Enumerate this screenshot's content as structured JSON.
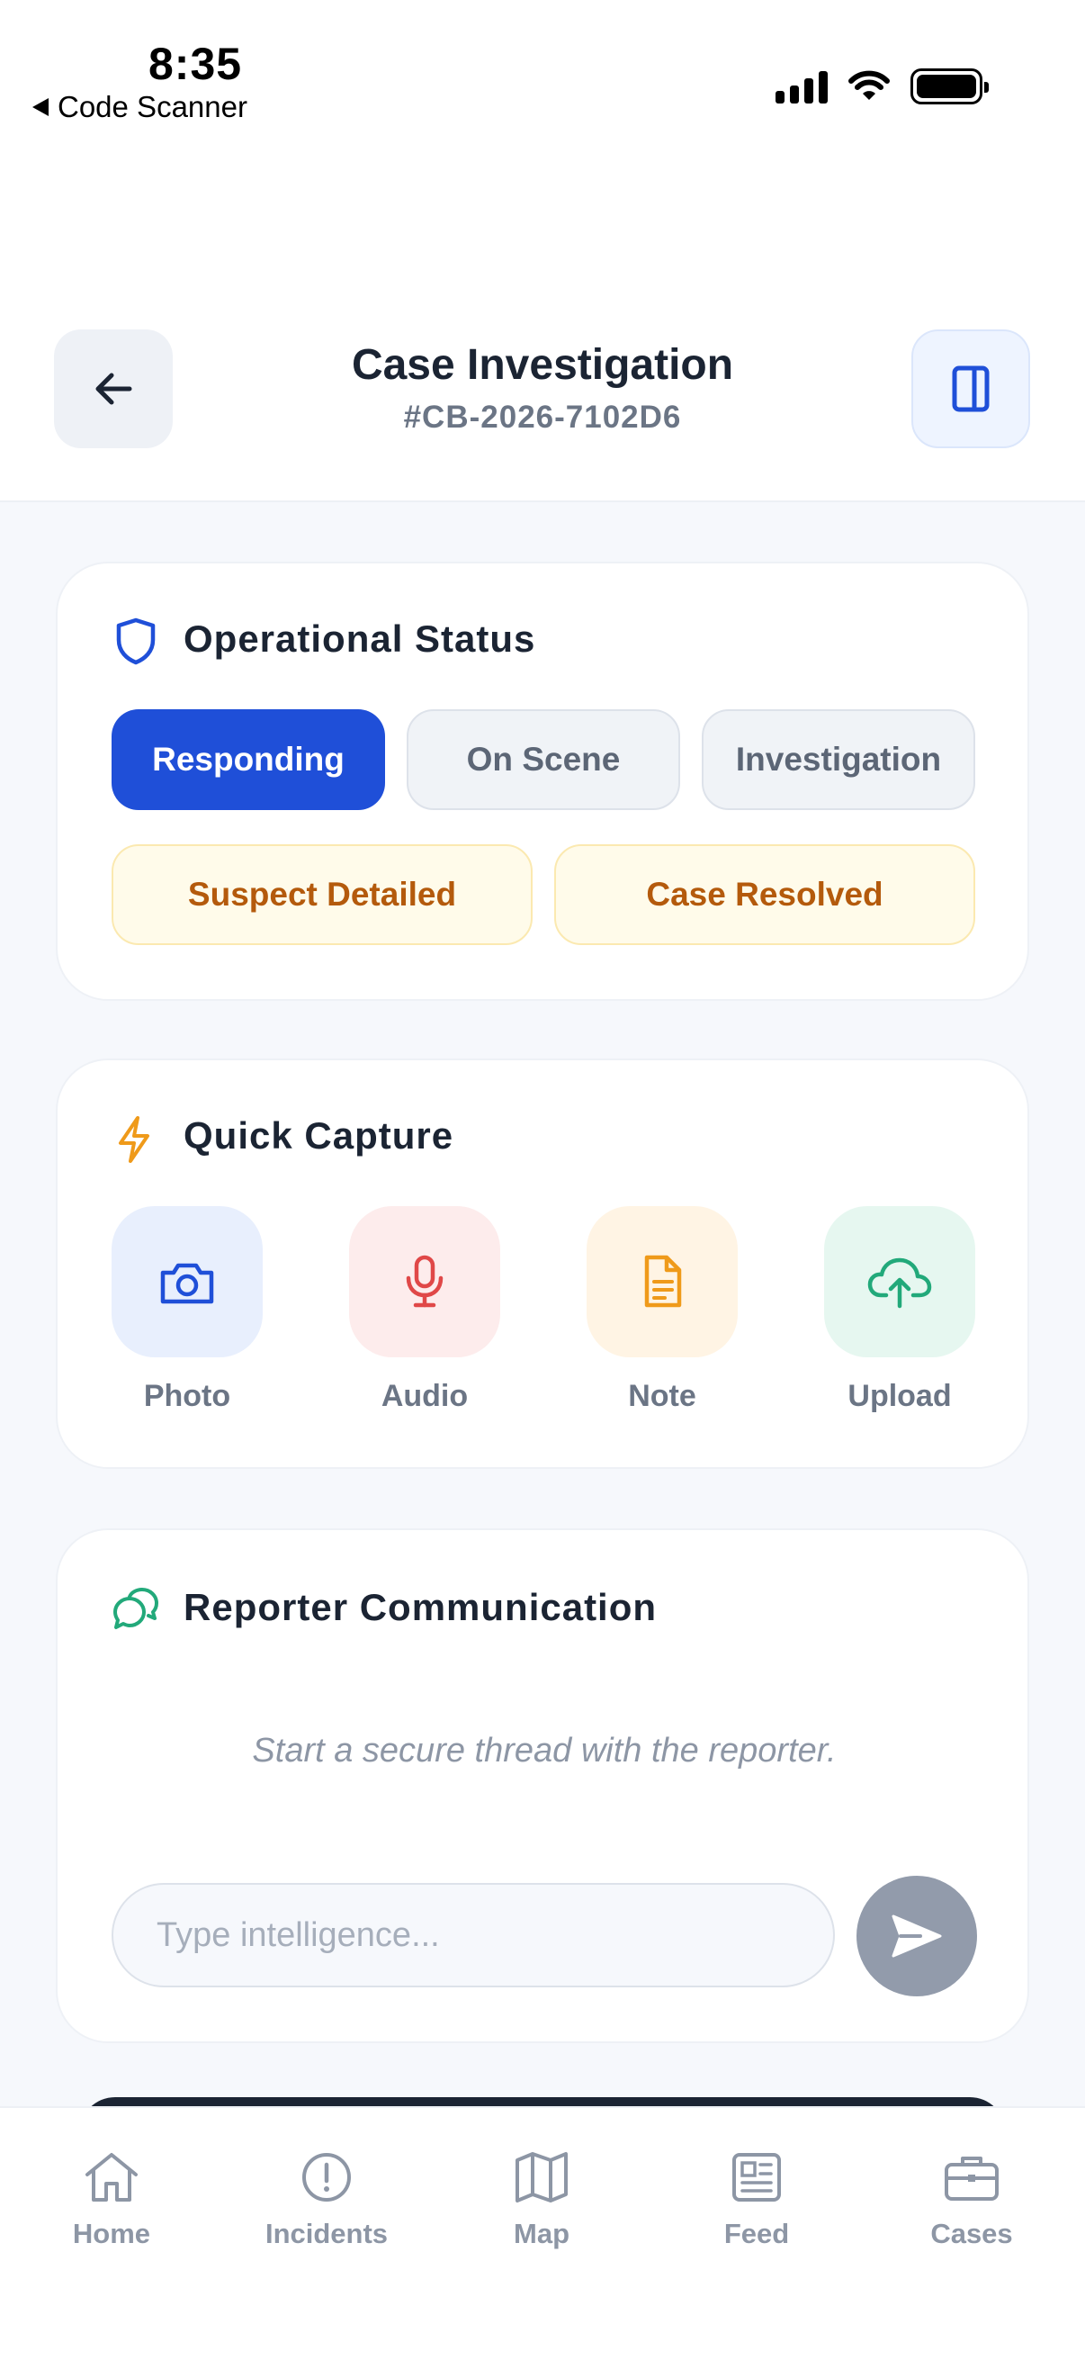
{
  "status_bar": {
    "time": "8:35",
    "back_app": "Code Scanner"
  },
  "header": {
    "title": "Case Investigation",
    "case_id": "#CB-2026-7102D6",
    "back_icon": "arrow-left-icon",
    "side_icon": "sidebar-panel-icon"
  },
  "operational_status": {
    "title": "Operational Status",
    "icon": "shield-icon",
    "options": [
      {
        "label": "Responding",
        "active": true
      },
      {
        "label": "On Scene",
        "active": false
      },
      {
        "label": "Investigation",
        "active": false
      },
      {
        "label": "Suspect Detailed",
        "active": false
      },
      {
        "label": "Case Resolved",
        "active": false
      }
    ]
  },
  "quick_capture": {
    "title": "Quick Capture",
    "icon": "lightning-icon",
    "items": [
      {
        "label": "Photo",
        "icon": "camera-icon",
        "color": "#1f4fd8"
      },
      {
        "label": "Audio",
        "icon": "microphone-icon",
        "color": "#e04848"
      },
      {
        "label": "Note",
        "icon": "document-icon",
        "color": "#ef9a1a"
      },
      {
        "label": "Upload",
        "icon": "cloud-upload-icon",
        "color": "#22a97a"
      }
    ]
  },
  "reporter_communication": {
    "title": "Reporter Communication",
    "icon": "chat-bubbles-icon",
    "empty_message": "Start a secure thread with the reporter.",
    "input_placeholder": "Type intelligence...",
    "input_value": ""
  },
  "bottom_nav": {
    "items": [
      {
        "label": "Home",
        "icon": "home-icon"
      },
      {
        "label": "Incidents",
        "icon": "alert-circle-icon"
      },
      {
        "label": "Map",
        "icon": "map-icon"
      },
      {
        "label": "Feed",
        "icon": "newspaper-icon"
      },
      {
        "label": "Cases",
        "icon": "briefcase-icon"
      }
    ]
  },
  "colors": {
    "accent": "#1f4fd8",
    "status_yellow_text": "#b45a0c",
    "send_button": "#929bab"
  }
}
